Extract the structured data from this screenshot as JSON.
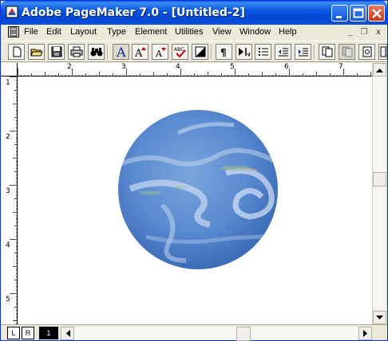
{
  "window": {
    "title": "Adobe PageMaker 7.0 - [Untitled-2]"
  },
  "menu": {
    "items": [
      "File",
      "Edit",
      "Layout",
      "Type",
      "Element",
      "Utilities",
      "View",
      "Window",
      "Help"
    ],
    "mdi_minimize": "_",
    "mdi_restore": "❐",
    "mdi_close": "x"
  },
  "toolbar": {
    "buttons": [
      "new",
      "open",
      "save",
      "print",
      "find",
      "text-frame",
      "font-increase",
      "font-decrease",
      "spell-check",
      "fill",
      "paragraph",
      "indent",
      "bullets",
      "decrease-indent",
      "increase-indent",
      "copy-page",
      "paste-page",
      "view",
      "more"
    ]
  },
  "rulers": {
    "horizontal_labels": [
      "2",
      "3",
      "4",
      "5",
      "6",
      "7"
    ],
    "vertical_labels": [
      "1",
      "2",
      "3",
      "4",
      "5"
    ]
  },
  "document": {
    "image": "planet-globe"
  },
  "pages": {
    "left_label": "L",
    "right_label": "R",
    "current_page": "1"
  },
  "colors": {
    "titlebar": "#0a58e0",
    "globe_base": "#5a8fd0",
    "globe_cloud": "#c8d8f0"
  }
}
